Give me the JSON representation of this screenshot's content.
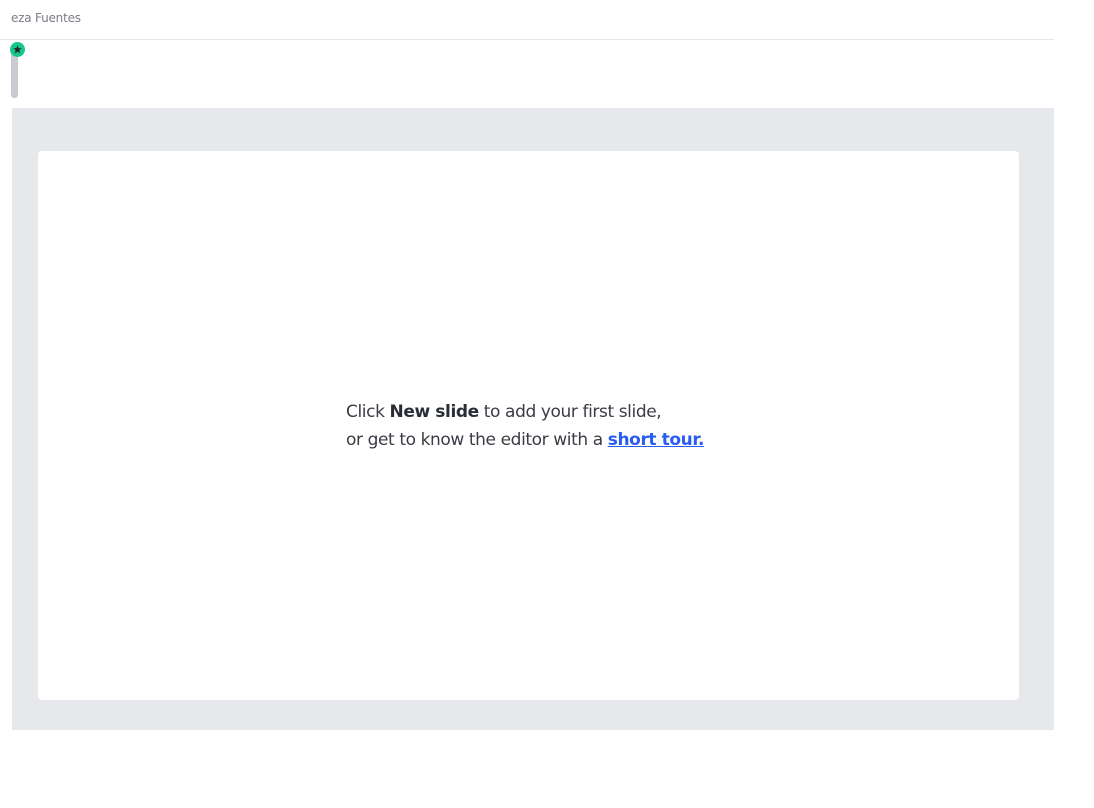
{
  "header": {
    "owner_name": "eza Fuentes"
  },
  "sidebar": {
    "badge_icon": "star-icon",
    "badge_color": "#19c68a"
  },
  "canvas": {
    "empty_state": {
      "line1_prefix": "Click ",
      "line1_bold": "New slide",
      "line1_suffix": " to add your first slide,",
      "line2_prefix": "or get to know the editor with a ",
      "line2_link": "short tour."
    },
    "link_color": "#2b5cf0"
  }
}
